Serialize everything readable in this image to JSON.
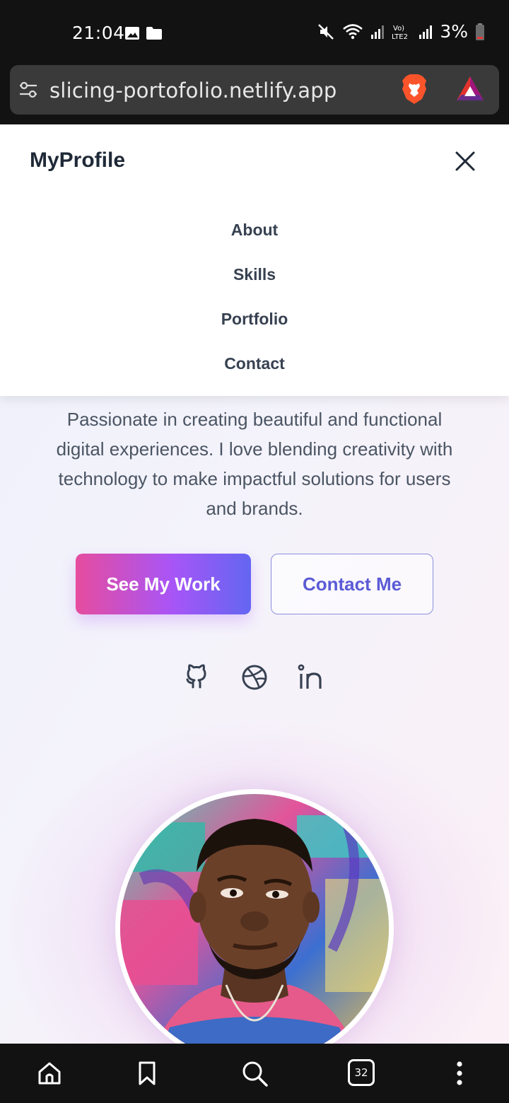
{
  "status_bar": {
    "time": "21:04",
    "battery": "3%",
    "icons": [
      "image-icon",
      "folder-icon",
      "mute-icon",
      "wifi-icon",
      "signal-icon",
      "volte-icon",
      "signal-icon",
      "battery-icon"
    ]
  },
  "browser": {
    "url": "slicing-portofolio.netlify.app",
    "tab_count": "32"
  },
  "nav": {
    "brand": "MyProfile",
    "links": [
      "About",
      "Skills",
      "Portfolio",
      "Contact"
    ]
  },
  "hero": {
    "bio_lines": [
      "Passionate in creating beautiful and functional",
      "digital experiences. I love blending creativity with",
      "technology to make impactful solutions for users",
      "and brands."
    ],
    "primary_button": "See My Work",
    "secondary_button": "Contact Me",
    "social": [
      "github-icon",
      "dribbble-icon",
      "linkedin-icon"
    ]
  },
  "colors": {
    "gradient_start": "#e64c9e",
    "gradient_end": "#6366f1",
    "accent_text": "#5b5bd6",
    "heading": "#1f2937"
  }
}
